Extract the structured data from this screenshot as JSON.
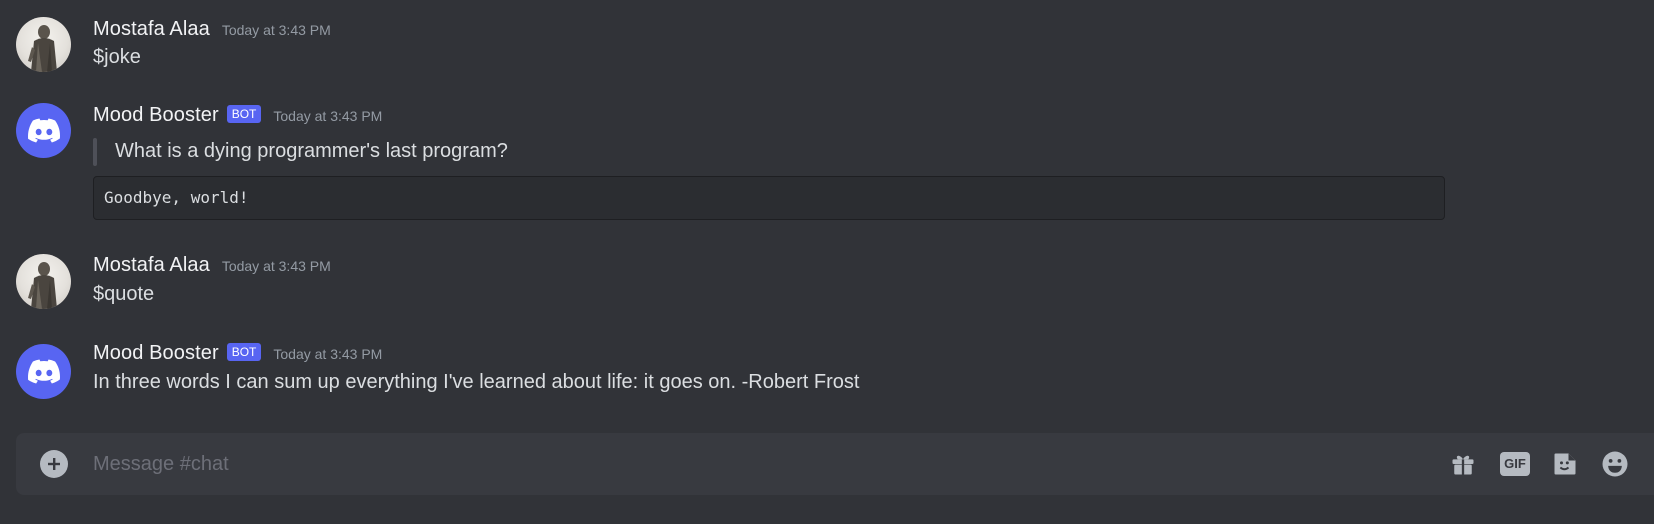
{
  "messages": [
    {
      "author": "Mostafa Alaa",
      "timestamp": "Today at 3:43 PM",
      "text": "$joke",
      "avatar": "user-avatar"
    },
    {
      "author": "Mood Booster",
      "bot_tag": "BOT",
      "timestamp": "Today at 3:43 PM",
      "quote": "What is a dying programmer's last program?",
      "code": "Goodbye, world!",
      "avatar": "discord-logo-icon"
    },
    {
      "author": "Mostafa Alaa",
      "timestamp": "Today at 3:43 PM",
      "text": "$quote",
      "avatar": "user-avatar"
    },
    {
      "author": "Mood Booster",
      "bot_tag": "BOT",
      "timestamp": "Today at 3:43 PM",
      "text": "In three words I can sum up everything I've learned about life: it goes on. -Robert Frost",
      "avatar": "discord-logo-icon"
    }
  ],
  "composer": {
    "placeholder": "Message #chat",
    "value": "",
    "gif_label": "GIF",
    "icons": [
      "plus-circle-icon",
      "gift-icon",
      "gif-icon",
      "sticker-icon",
      "emoji-icon"
    ]
  },
  "colors": {
    "background": "#313338",
    "composer": "#383a40",
    "blurple": "#5865f2",
    "code_bg": "#2b2d31",
    "muted": "#949ba4"
  }
}
